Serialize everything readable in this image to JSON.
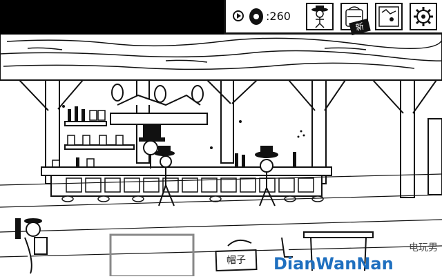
{
  "hud": {
    "meat_count": ":260",
    "new_badge": "新",
    "icons": [
      "play-icon",
      "meat-icon",
      "cowboy-character-icon",
      "backpack-icon",
      "map-icon",
      "gear-icon"
    ]
  },
  "scene": {
    "shop_sign": "帽子"
  },
  "watermark": {
    "main": "DianWanNan",
    "corner": "电玩男"
  }
}
